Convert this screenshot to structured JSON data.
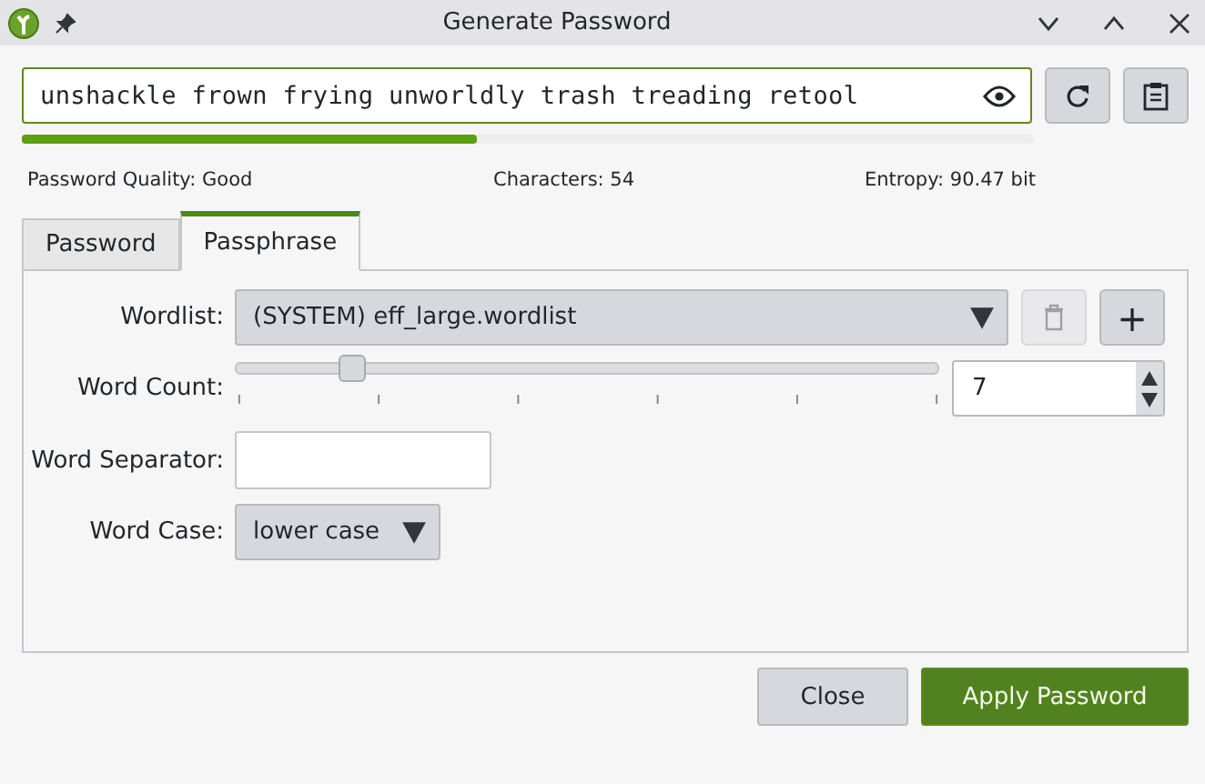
{
  "window": {
    "title": "Generate Password"
  },
  "password": {
    "value": "unshackle frown frying unworldly trash treading retool",
    "level": 0.45
  },
  "stats": [
    "Password Quality: Good",
    "Characters: 54",
    "Entropy: 90.47 bit"
  ],
  "tabs": [
    {
      "label": "Password",
      "selected": false
    },
    {
      "label": "Passphrase",
      "selected": true
    }
  ],
  "wordlist": {
    "label": "Wordlist:",
    "value": "(SYSTEM) eff_large.wordlist",
    "delete_disabled": true,
    "add": "+"
  },
  "word_count": {
    "label": "Word Count:",
    "level": 0.165,
    "value": "7"
  },
  "word_separator": {
    "label": "Word Separator:"
  },
  "word_case": {
    "label": "Word Case:",
    "value": "lower case"
  },
  "buttons": [
    {
      "label": "Close",
      "kind": "default"
    },
    {
      "label": "Apply Password",
      "kind": "primary"
    }
  ]
}
